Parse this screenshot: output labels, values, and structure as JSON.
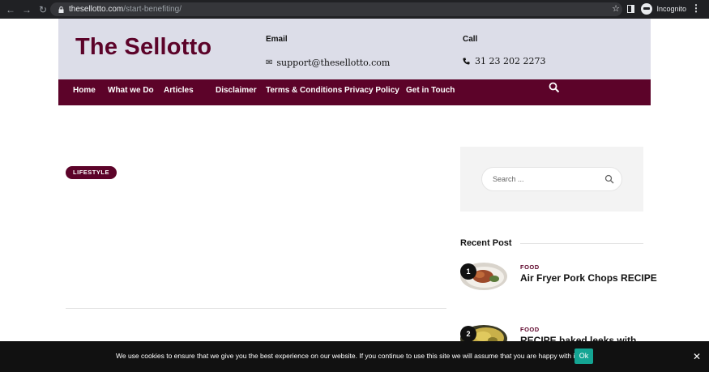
{
  "browser": {
    "url_host": "thesellotto.com",
    "url_path": "/start-benefiting/",
    "profile_label": "Incognito"
  },
  "site": {
    "logo": "The Sellotto",
    "email_label": "Email",
    "email_value": "support@thesellotto.com",
    "call_label": "Call",
    "call_value": "31 23 202 2273"
  },
  "nav": {
    "items": [
      "Home",
      "What we Do",
      "Articles",
      "Disclaimer",
      "Terms & Conditions",
      "Privacy Policy",
      "Get in Touch"
    ]
  },
  "article": {
    "category_badge": "LIFESTYLE"
  },
  "sidebar": {
    "search_placeholder": "Search ...",
    "recent_title": "Recent Post",
    "posts": [
      {
        "num": "1",
        "category": "FOOD",
        "title": "Air Fryer Pork Chops RECIPE"
      },
      {
        "num": "2",
        "category": "FOOD",
        "title": "RECIPE baked leeks with"
      }
    ]
  },
  "cookie": {
    "text": "We use cookies to ensure that we give you the best experience on our website. If you continue to use this site we will assume that you are happy with it.",
    "ok_label": "Ok",
    "close_label": "✕"
  },
  "colors": {
    "brand": "#5c0329",
    "header_bg": "#dcdde8",
    "cookie_ok": "#14a593"
  }
}
